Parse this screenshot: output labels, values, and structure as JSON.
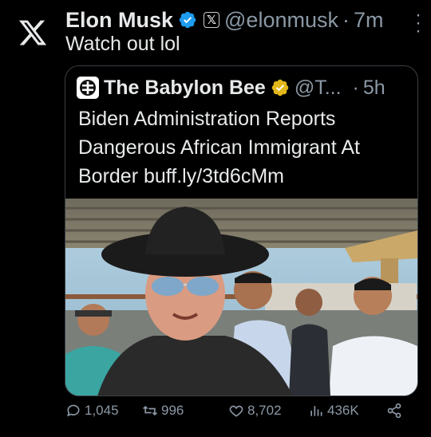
{
  "tweet": {
    "author_name": "Elon Musk",
    "author_handle": "@elonmusk",
    "separator": "·",
    "time": "7m",
    "affiliate_badge": "𝕏",
    "text": "Watch out lol"
  },
  "quoted": {
    "author_name": "The Babylon Bee",
    "author_handle": "@T...",
    "separator": "·",
    "time": "5h",
    "text": "Biden Administration Reports Dangerous African Immigrant At Border buff.ly/3td6cMm"
  },
  "actions": {
    "replies": "1,045",
    "reposts": "996",
    "likes": "8,702",
    "views": "436K"
  },
  "icons": {
    "logo": "x-logo-icon",
    "verified": "blue-verified-icon",
    "org_verified": "gold-verified-icon",
    "more": "more-icon",
    "reply": "reply-icon",
    "repost": "repost-icon",
    "like": "heart-icon",
    "views": "views-icon",
    "share": "share-icon"
  },
  "colors": {
    "background": "#000000",
    "text": "#e7e9ea",
    "muted": "#8b98a5",
    "verified_blue": "#1d9bf0",
    "verified_gold": "#e2b719"
  }
}
